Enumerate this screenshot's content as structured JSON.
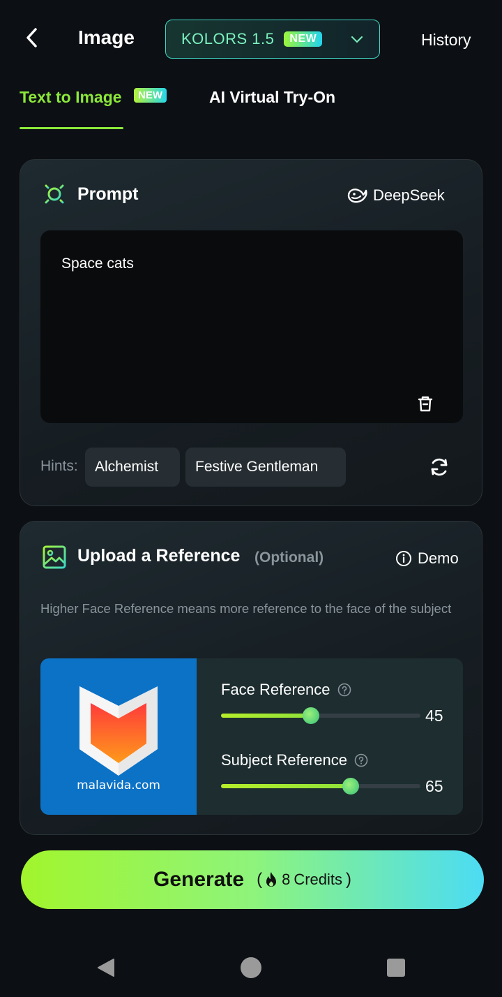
{
  "header": {
    "title": "Image",
    "model_name": "KOLORS 1.5",
    "model_badge": "NEW",
    "history_label": "History"
  },
  "tabs": [
    {
      "label": "Text to Image",
      "badge": "NEW",
      "active": true
    },
    {
      "label": "AI Virtual Try-On",
      "active": false
    }
  ],
  "prompt_card": {
    "title": "Prompt",
    "deepseek_label": "DeepSeek",
    "prompt_value": "Space cats",
    "hints_label": "Hints:",
    "hints": [
      "Alchemist",
      "Festive Gentleman"
    ]
  },
  "reference_card": {
    "title": "Upload a Reference",
    "optional_label": "(Optional)",
    "demo_label": "Demo",
    "description": "Higher Face Reference means more reference to the face of the subject",
    "image_caption": "malavida.com",
    "sliders": [
      {
        "label": "Face Reference",
        "value": 45
      },
      {
        "label": "Subject Reference",
        "value": 65
      }
    ]
  },
  "generate": {
    "label": "Generate",
    "credits_count": "8",
    "credits_word": "Credits"
  },
  "colors": {
    "accent_green": "#8be83a",
    "model_text": "#7cf2bf",
    "button_gradient_start": "#a2f52c",
    "button_gradient_end": "#4cdcf4",
    "background": "#0c0f13"
  },
  "icons": {
    "back": "chevron-left-icon",
    "model_dropdown": "chevron-down-icon",
    "prompt": "sun-icon",
    "deepseek": "deepseek-whale-icon",
    "clear_prompt": "trash-icon",
    "refresh_hints": "refresh-icon",
    "reference": "image-icon",
    "demo": "info-icon",
    "help": "question-circle-icon",
    "credits": "flame-icon",
    "nav_back": "triangle-back-icon",
    "nav_home": "circle-home-icon",
    "nav_recent": "square-recent-icon"
  }
}
